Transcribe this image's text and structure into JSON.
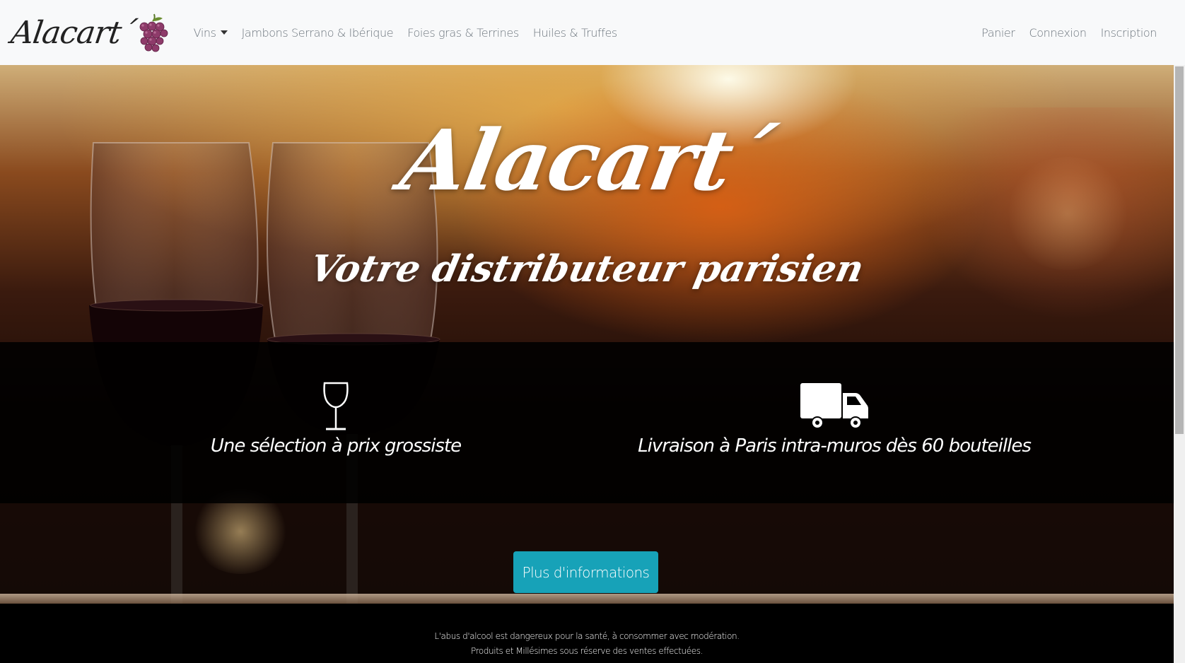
{
  "brand": {
    "name": "Alacart´",
    "logo_label": "Alacart´"
  },
  "nav": {
    "left": [
      {
        "label": "Vins",
        "has_dropdown": true
      },
      {
        "label": "Jambons Serrano & Ibérique"
      },
      {
        "label": "Foies gras & Terrines"
      },
      {
        "label": "Huiles & Truffes"
      }
    ],
    "right": [
      {
        "label": "Panier"
      },
      {
        "label": "Connexion"
      },
      {
        "label": "Inscription"
      }
    ]
  },
  "hero": {
    "title": "Alacart´",
    "subtitle": "Votre distributeur parisien",
    "features": [
      {
        "icon": "wine-glass-icon",
        "text": "Une sélection à prix grossiste"
      },
      {
        "icon": "delivery-truck-icon",
        "text": "Livraison à Paris intra-muros dès 60 bouteilles"
      }
    ],
    "cta_label": "Plus d'informations"
  },
  "legal": {
    "line1": "L'abus d'alcool est dangereux pour la santé, à consommer avec modération.",
    "line2": "Produits et Millésimes sous réserve des ventes effectuées."
  },
  "colors": {
    "accent": "#17a2b8",
    "navbar_bg": "#f8f9fa",
    "nav_text": "#6c757d"
  }
}
